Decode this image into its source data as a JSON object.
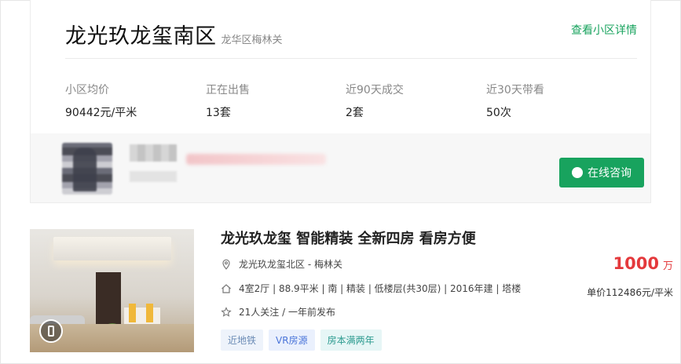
{
  "community": {
    "name": "龙光玖龙玺南区",
    "district": "龙华区梅林关",
    "detail_link": "查看小区详情",
    "stats": [
      {
        "label": "小区均价",
        "value": "90442元/平米"
      },
      {
        "label": "正在出售",
        "value": "13套"
      },
      {
        "label": "近90天成交",
        "value": "2套"
      },
      {
        "label": "近30天带看",
        "value": "50次"
      }
    ]
  },
  "agent": {
    "consult_label": "在线咨询"
  },
  "listing": {
    "title": "龙光玖龙玺 智能精装 全新四房 看房方便",
    "location": "龙光玖龙玺北区 - 梅林关",
    "details": "4室2厅 | 88.9平米 | 南 | 精装 | 低楼层(共30层) | 2016年建 | 塔楼",
    "followers": "21人关注 / 一年前发布",
    "price_value": "1000",
    "price_unit": "万",
    "unit_price": "单价112486元/平米",
    "tags": [
      {
        "label": "近地铁",
        "bg": "#eef3fb",
        "color": "#6b8bb5"
      },
      {
        "label": "VR房源",
        "bg": "#eaf0fd",
        "color": "#4a74d9"
      },
      {
        "label": "房本满两年",
        "bg": "#e6f6f6",
        "color": "#2a9a8e"
      }
    ]
  },
  "colors": {
    "accent_green": "#18a35e",
    "price_red": "#e4393c"
  }
}
